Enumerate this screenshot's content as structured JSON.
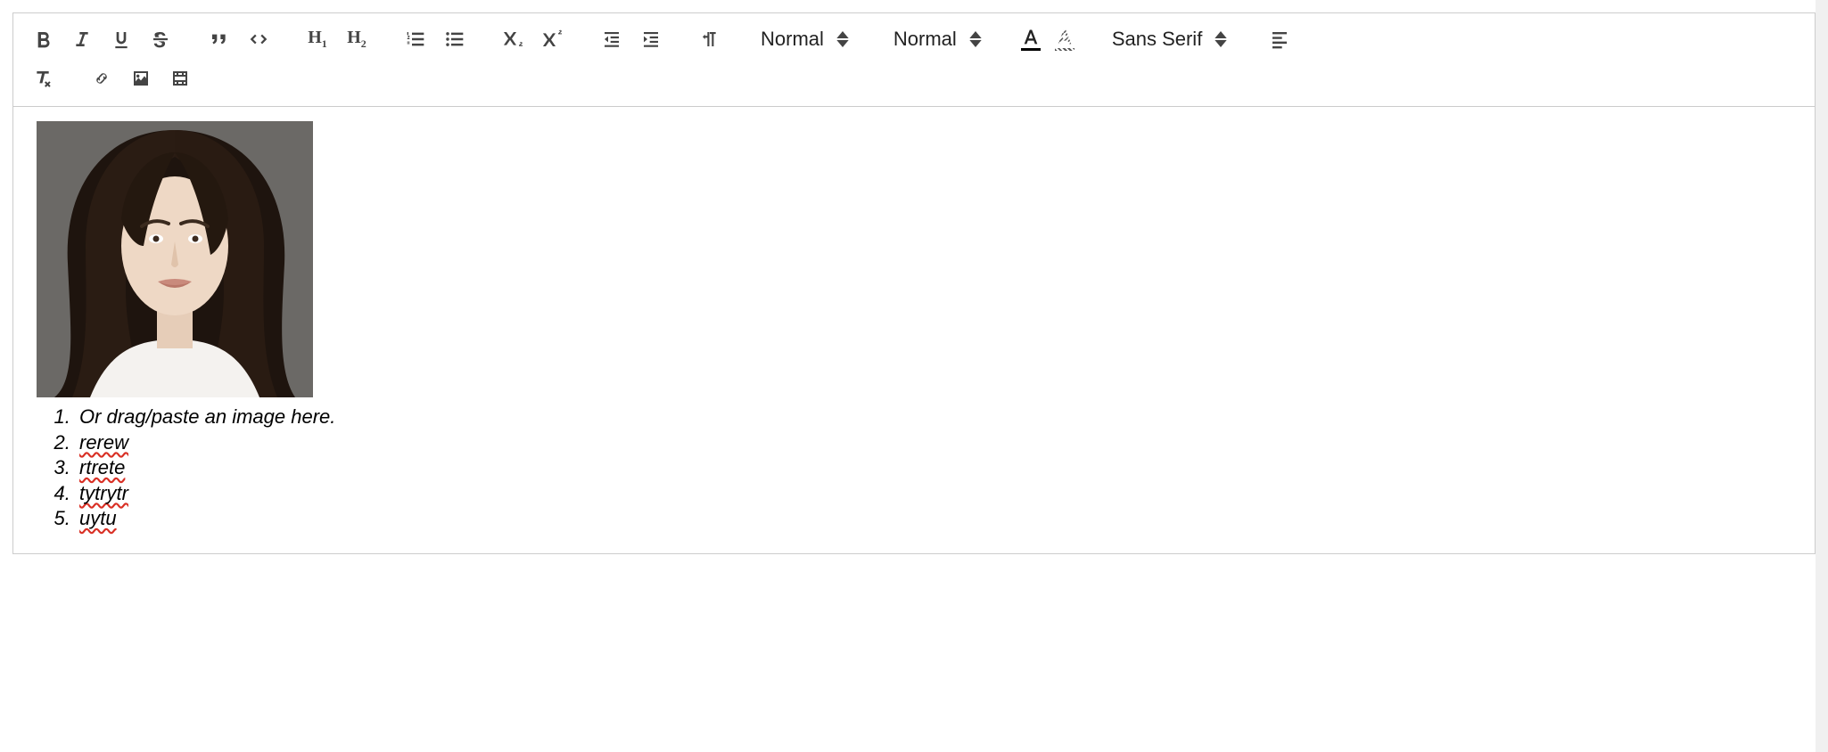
{
  "toolbar": {
    "header_picker": "Normal",
    "size_picker": "Normal",
    "font_picker": "Sans Serif",
    "text_color": "#000000",
    "bg_color": "#888888"
  },
  "content": {
    "list_items": [
      "Or drag/paste an image here.",
      "rerew",
      "rtrete",
      "tytrytr",
      "uytu"
    ]
  }
}
